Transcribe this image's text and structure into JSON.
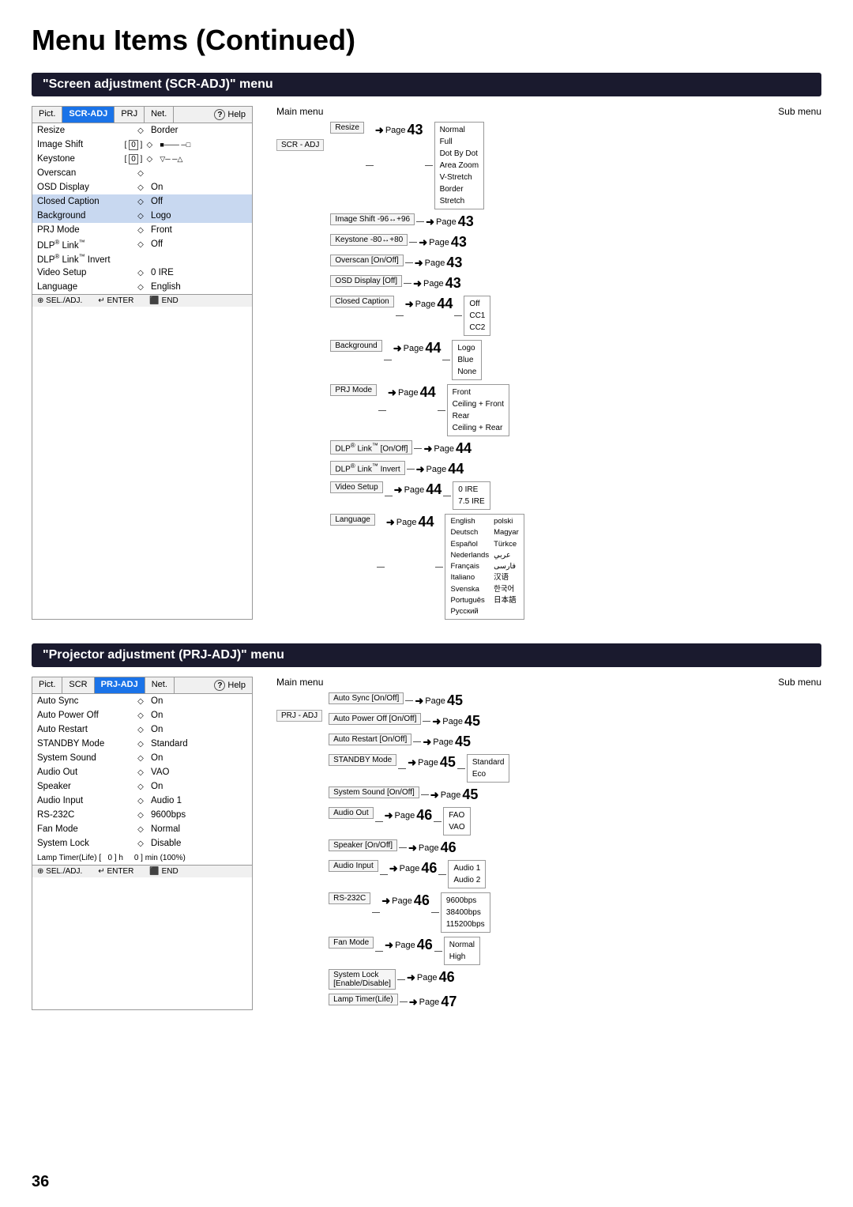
{
  "page": {
    "title": "Menu Items (Continued)",
    "page_number": "36"
  },
  "scr_section": {
    "header": "\"Screen adjustment (SCR-ADJ)\" menu",
    "menu": {
      "tabs": [
        "Pict.",
        "SCR-ADJ",
        "PRJ",
        "Net.",
        "Help"
      ],
      "active_tab": "SCR-ADJ",
      "rows": [
        {
          "label": "Resize",
          "icon": "◇",
          "value": "Border"
        },
        {
          "label": "Image Shift",
          "bracket": "0",
          "icon": "◇",
          "value": ""
        },
        {
          "label": "Keystone",
          "bracket": "0",
          "icon": "◇",
          "value": ""
        },
        {
          "label": "Overscan",
          "icon": "◇",
          "value": ""
        },
        {
          "label": "OSD Display",
          "icon": "◇",
          "value": "On"
        },
        {
          "label": "Closed Caption",
          "icon": "◇",
          "value": "Off"
        },
        {
          "label": "Background",
          "icon": "◇",
          "value": "Logo"
        },
        {
          "label": "PRJ Mode",
          "icon": "◇",
          "value": "Front"
        },
        {
          "label": "DLP® Link™",
          "icon": "◇",
          "value": "Off"
        },
        {
          "label": "DLP® Link™ Invert",
          "icon": "",
          "value": ""
        },
        {
          "label": "Video Setup",
          "icon": "◇",
          "value": "0 IRE"
        },
        {
          "label": "Language",
          "icon": "◇",
          "value": "English"
        }
      ],
      "footer": [
        "SEL./ADJ.",
        "ENTER",
        "END"
      ]
    },
    "main_menu_label": "Main menu",
    "sub_menu_label": "Sub menu",
    "diagram_start_label": "SCR - ADJ",
    "diagram_rows": [
      {
        "item_label": "Resize",
        "page": "43",
        "sub_options": [
          "Normal",
          "Full",
          "Dot By Dot",
          "Area Zoom",
          "V-Stretch",
          "Border",
          "Stretch"
        ]
      },
      {
        "item_label": "Image Shift  -96↔+96",
        "page": "43",
        "sub_options": []
      },
      {
        "item_label": "Keystone  -80↔+80",
        "page": "43",
        "sub_options": []
      },
      {
        "item_label": "Overscan [On/Off]",
        "page": "43",
        "sub_options": []
      },
      {
        "item_label": "OSD Display [Off]",
        "page": "43",
        "sub_options": []
      },
      {
        "item_label": "Closed Caption",
        "page": "44",
        "sub_options": [
          "Off",
          "CC1",
          "CC2"
        ]
      },
      {
        "item_label": "Background",
        "page": "44",
        "sub_options": [
          "Logo",
          "Blue",
          "None"
        ]
      },
      {
        "item_label": "PRJ Mode",
        "page": "44",
        "sub_options": [
          "Front",
          "Ceiling + Front",
          "Rear",
          "Ceiling + Rear"
        ]
      },
      {
        "item_label": "DLP® Link™ [On/Off]",
        "page": "44",
        "sub_options": []
      },
      {
        "item_label": "DLP® Link™ Invert",
        "page": "44",
        "sub_options": []
      },
      {
        "item_label": "Video Setup",
        "page": "44",
        "sub_options": [
          "0 IRE",
          "7.5 IRE"
        ]
      },
      {
        "item_label": "Language",
        "page": "44",
        "sub_options_lang": [
          "English",
          "Deutsch",
          "Español",
          "Nederlands",
          "Français",
          "Italiano",
          "Svenska",
          "Português",
          "Русский",
          "polski",
          "Magyar",
          "Türkce",
          "عربي",
          "فارسی",
          "汉语",
          "한국어",
          "日本語"
        ]
      }
    ]
  },
  "prj_section": {
    "header": "\"Projector adjustment (PRJ-ADJ)\" menu",
    "menu": {
      "tabs": [
        "Pict.",
        "SCR",
        "PRJ-ADJ",
        "Net.",
        "Help"
      ],
      "active_tab": "PRJ-ADJ",
      "rows": [
        {
          "label": "Auto Sync",
          "icon": "◇",
          "value": "On"
        },
        {
          "label": "Auto Power Off",
          "icon": "◇",
          "value": "On"
        },
        {
          "label": "Auto Restart",
          "icon": "◇",
          "value": "On"
        },
        {
          "label": "STANDBY Mode",
          "icon": "◇",
          "value": "Standard"
        },
        {
          "label": "System Sound",
          "icon": "◇",
          "value": "On"
        },
        {
          "label": "Audio Out",
          "icon": "◇",
          "value": "VAO"
        },
        {
          "label": "Speaker",
          "icon": "◇",
          "value": "On"
        },
        {
          "label": "Audio Input",
          "icon": "◇",
          "value": "Audio 1"
        },
        {
          "label": "RS-232C",
          "icon": "◇",
          "value": "9600bps"
        },
        {
          "label": "Fan Mode",
          "icon": "◇",
          "value": "Normal"
        },
        {
          "label": "System Lock",
          "icon": "◇",
          "value": "Disable"
        }
      ],
      "lamp_row": "Lamp Timer(Life) [   0 ] h     0 ] min (100%)",
      "footer": [
        "SEL./ADJ.",
        "ENTER",
        "END"
      ]
    },
    "main_menu_label": "Main menu",
    "sub_menu_label": "Sub menu",
    "diagram_start_label": "PRJ - ADJ",
    "diagram_rows": [
      {
        "item_label": "Auto Sync [On/Off]",
        "page": "45",
        "sub_options": []
      },
      {
        "item_label": "Auto Power Off [On/Off]",
        "page": "45",
        "sub_options": []
      },
      {
        "item_label": "Auto Restart [On/Off]",
        "page": "45",
        "sub_options": []
      },
      {
        "item_label": "STANDBY Mode",
        "page": "45",
        "sub_options": [
          "Standard",
          "Eco"
        ]
      },
      {
        "item_label": "System Sound [On/Off]",
        "page": "45",
        "sub_options": []
      },
      {
        "item_label": "Audio Out",
        "page": "46",
        "sub_options": [
          "FAO",
          "VAO"
        ]
      },
      {
        "item_label": "Speaker [On/Off]",
        "page": "46",
        "sub_options": []
      },
      {
        "item_label": "Audio Input",
        "page": "46",
        "sub_options": [
          "Audio 1",
          "Audio 2"
        ]
      },
      {
        "item_label": "RS-232C",
        "page": "46",
        "sub_options": [
          "9600bps",
          "38400bps",
          "115200bps"
        ]
      },
      {
        "item_label": "Fan Mode",
        "page": "46",
        "sub_options": [
          "Normal",
          "High"
        ]
      },
      {
        "item_label": "System Lock\n[Enable/Disable]",
        "page": "46",
        "sub_options": []
      },
      {
        "item_label": "Lamp Timer(Life)",
        "page": "47",
        "sub_options": []
      }
    ]
  }
}
